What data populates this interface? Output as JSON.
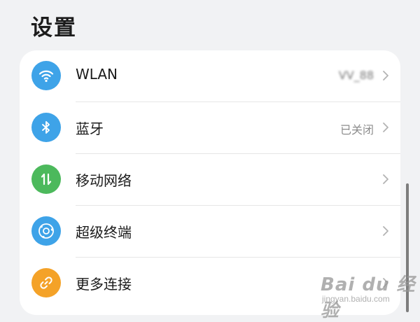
{
  "header": {
    "title": "设置"
  },
  "settings": {
    "items": [
      {
        "label": "WLAN",
        "value": "VV_88",
        "icon": "wifi-icon",
        "icon_color": "#3ea3e8"
      },
      {
        "label": "蓝牙",
        "value": "已关闭",
        "icon": "bluetooth-icon",
        "icon_color": "#3ea3e8"
      },
      {
        "label": "移动网络",
        "value": "",
        "icon": "mobile-data-icon",
        "icon_color": "#4cb95c"
      },
      {
        "label": "超级终端",
        "value": "",
        "icon": "super-device-icon",
        "icon_color": "#3ea3e8"
      },
      {
        "label": "更多连接",
        "value": "",
        "icon": "link-icon",
        "icon_color": "#f4a228"
      }
    ]
  },
  "watermark": {
    "brand": "Bai du 经验",
    "sub": "jingyan.baidu.com"
  },
  "colors": {
    "background": "#f1f2f4",
    "card": "#ffffff",
    "accent_blue": "#3ea3e8",
    "accent_green": "#4cb95c",
    "accent_orange": "#f4a228"
  }
}
